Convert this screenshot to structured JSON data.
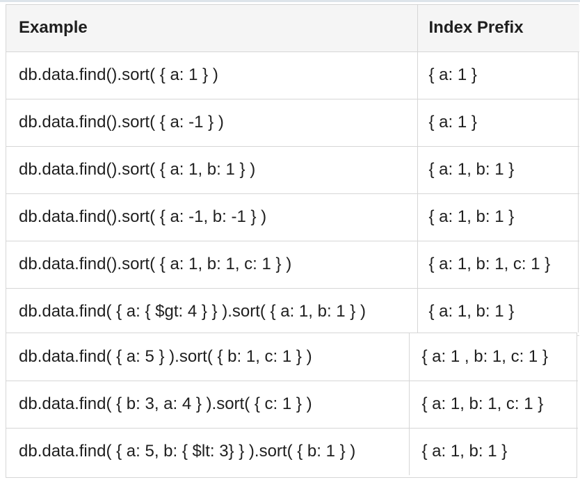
{
  "table": {
    "headers": [
      "Example",
      "Index Prefix"
    ],
    "rows": [
      [
        "db.data.find().sort( { a: 1 } )",
        "{ a: 1 }"
      ],
      [
        "db.data.find().sort( { a: -1 } )",
        "{ a: 1 }"
      ],
      [
        "db.data.find().sort( { a: 1, b: 1 } )",
        "{ a: 1, b: 1 }"
      ],
      [
        "db.data.find().sort( { a: -1, b: -1 } )",
        "{ a: 1, b: 1 }"
      ],
      [
        "db.data.find().sort( { a: 1, b: 1, c: 1 } )",
        "{ a: 1, b: 1, c: 1 }"
      ],
      [
        "db.data.find( { a: { $gt: 4 } } ).sort( { a: 1, b: 1 } )",
        "{ a: 1, b: 1 }"
      ],
      [
        "db.data.find( { a: 5 } ).sort( { b: 1, c: 1 } )",
        "{ a: 1 , b: 1, c: 1 }"
      ],
      [
        "db.data.find( { b: 3, a: 4 } ).sort( { c: 1 } )",
        "{ a: 1, b: 1, c: 1 }"
      ],
      [
        "db.data.find( { a: 5, b: { $lt: 3} } ).sort( { b: 1 } )",
        "{ a: 1, b: 1 }"
      ]
    ]
  }
}
